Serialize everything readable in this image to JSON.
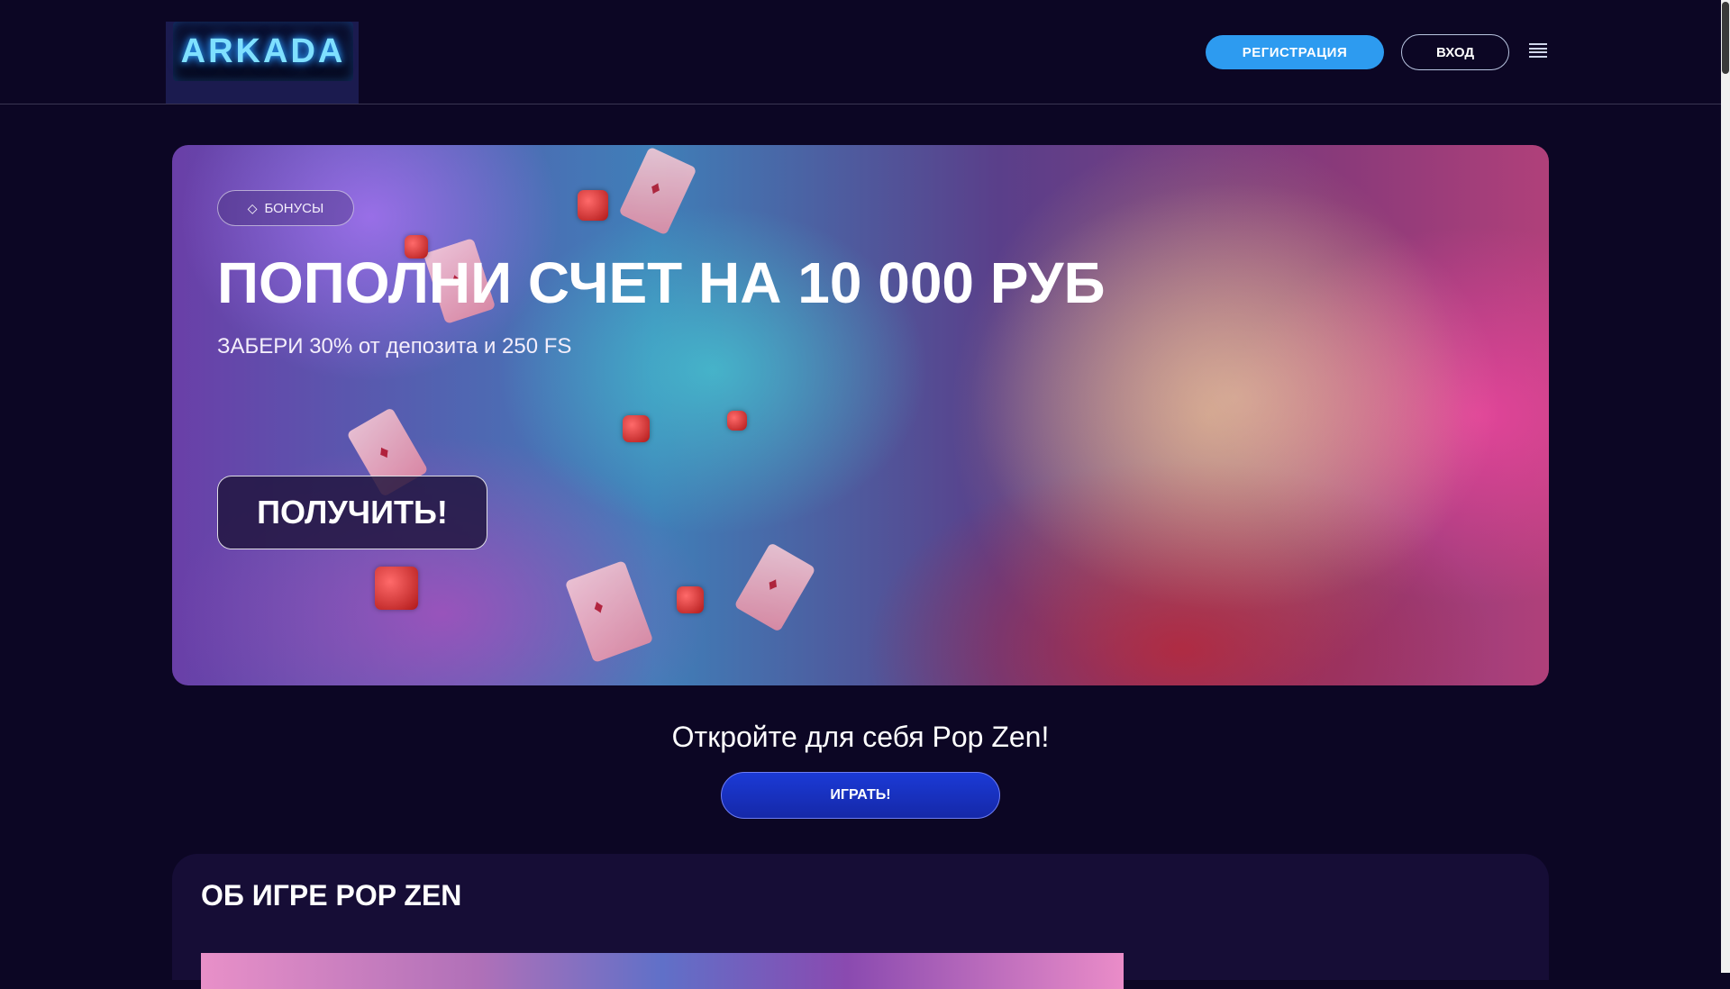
{
  "header": {
    "logo_text": "ARKADA",
    "register_label": "РЕГИСТРАЦИЯ",
    "login_label": "ВХОД",
    "menu_icon": "hamburger-menu-icon"
  },
  "hero": {
    "badge_icon": "diamond-icon",
    "badge_label": "БОНУСЫ",
    "title": "ПОПОЛНИ СЧЕТ НА 10 000 РУБ",
    "subtitle": "ЗАБЕРИ 30% от депозита и 250 FS",
    "cta_label": "ПОЛУЧИТЬ!"
  },
  "discover": {
    "title": "Откройте для себя Pop Zen!",
    "play_label": "ИГРАТЬ!"
  },
  "about": {
    "title": "ОБ ИГРЕ POP ZEN"
  },
  "colors": {
    "background": "#0c0624",
    "accent_blue": "#2d9bf0",
    "play_button": "#1b3ad6",
    "about_panel": "#160d36"
  }
}
